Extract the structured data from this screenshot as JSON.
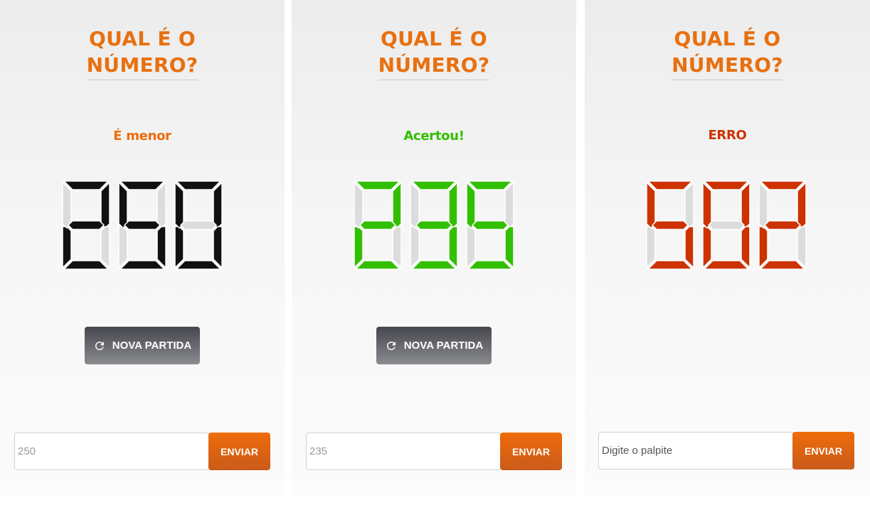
{
  "colors": {
    "accent": "#e8700f",
    "segment_off": "#dcdcdc",
    "segment_outline": "#ffffff"
  },
  "panels": [
    {
      "title_line1": "QUAL É O",
      "title_line2": "NÚMERO?",
      "status": "É menor",
      "status_color": "#ee6a0b",
      "digits": "250",
      "digit_color": "#111111",
      "restart_label": "NOVA PARTIDA",
      "restart_icon": "refresh-icon",
      "input_placeholder": "250",
      "send_label": "ENVIAR"
    },
    {
      "title_line1": "QUAL É O",
      "title_line2": "NÚMERO?",
      "status": "Acertou!",
      "status_color": "#32bf00",
      "digits": "235",
      "digit_color": "#32bf00",
      "restart_label": "NOVA PARTIDA",
      "restart_icon": "refresh-icon",
      "input_placeholder": "235",
      "send_label": "ENVIAR"
    },
    {
      "title_line1": "QUAL É O",
      "title_line2": "NÚMERO?",
      "status": "ERRO",
      "status_color": "#cc3300",
      "digits": "502",
      "digit_color": "#cc3300",
      "input_placeholder": "Digite o palpite",
      "send_label": "ENVIAR"
    }
  ]
}
